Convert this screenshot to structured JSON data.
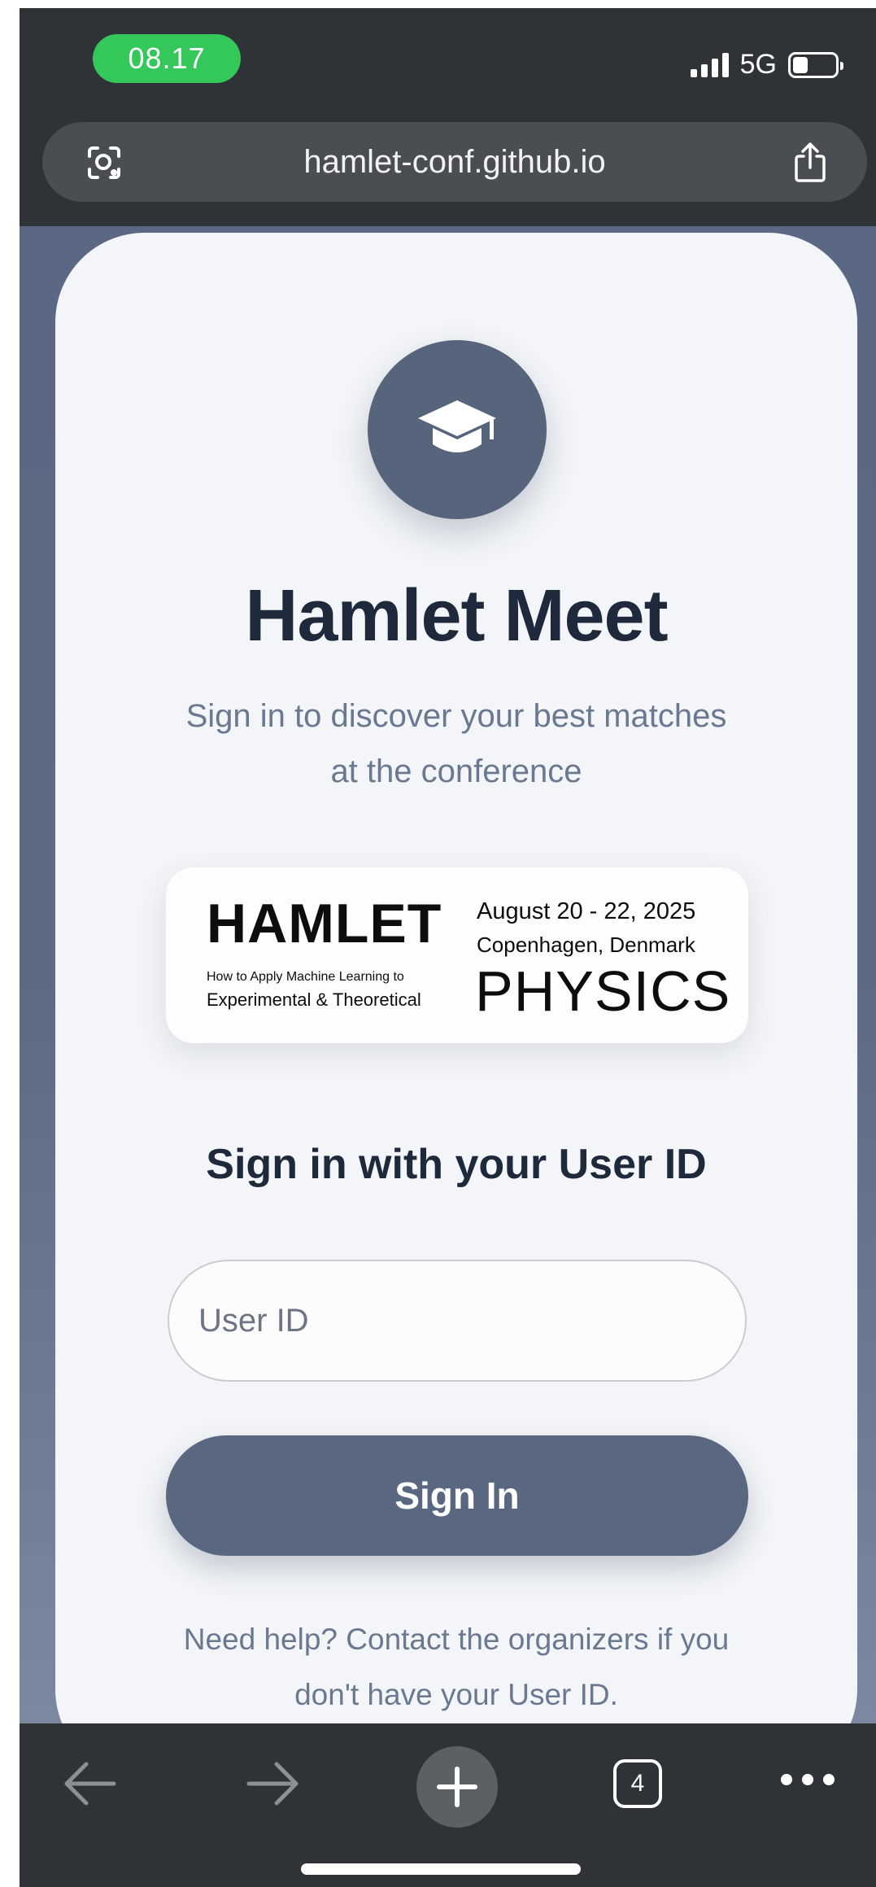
{
  "status_bar": {
    "time": "08.17",
    "network": "5G"
  },
  "browser": {
    "url": "hamlet-conf.github.io",
    "tab_count": "4",
    "icons": [
      "lens-icon",
      "share-icon",
      "back-arrow-icon",
      "forward-arrow-icon",
      "plus-icon",
      "tabs-icon",
      "more-icon"
    ]
  },
  "page": {
    "logo_icon": "graduation-cap-icon",
    "title": "Hamlet Meet",
    "subtitle": "Sign in to discover your best matches at the conference",
    "banner": {
      "hamlet": "HAMLET",
      "apply_line1": "How to Apply Machine Learning to",
      "apply_line2": "Experimental & Theoretical",
      "dates": "August 20 - 22, 2025",
      "place": "Copenhagen, Denmark",
      "physics": "PHYSICS"
    },
    "form_heading": "Sign in with your User ID",
    "userid_placeholder": "User ID",
    "signin_label": "Sign In",
    "help_text": "Need help? Contact the organizers if you don't have your User ID."
  },
  "colors": {
    "accent": "#5a6781",
    "title": "#1e2a3c",
    "status_green": "#34c759"
  }
}
